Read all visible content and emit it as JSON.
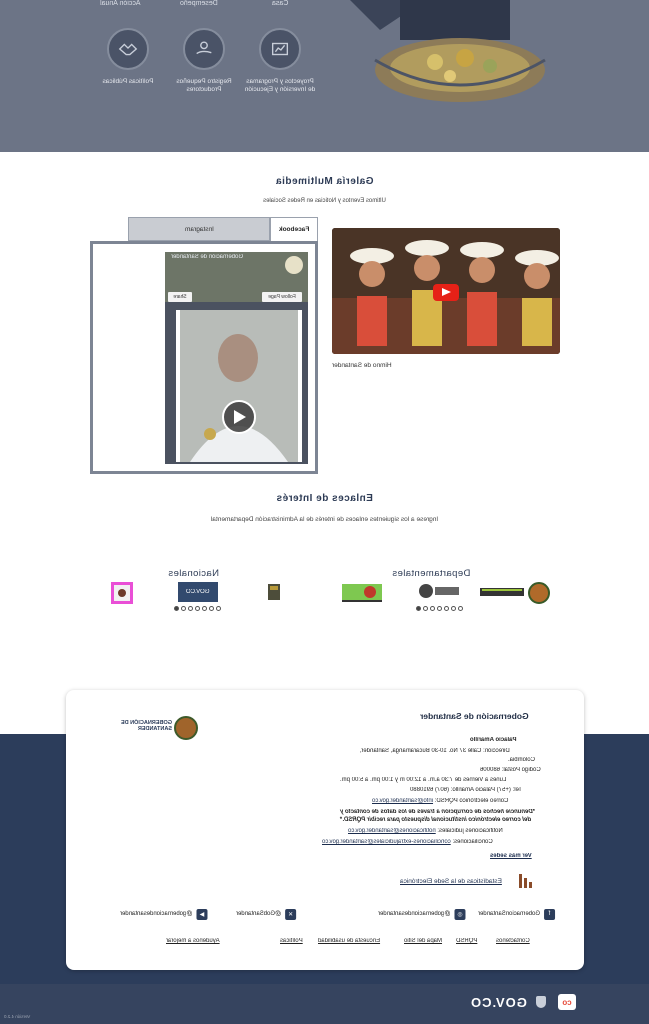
{
  "hero": {
    "captions": [
      "Acción Anual",
      "Desempeño",
      "Casa"
    ],
    "cards": [
      {
        "label": "Proyectos y Programas de Inversión y Ejecución",
        "icon": "folder-chart-icon"
      },
      {
        "label": "Registro Pequeños Productores",
        "icon": "hand-coins-icon"
      },
      {
        "label": "Políticas Públicas",
        "icon": "handshake-icon"
      }
    ]
  },
  "gallery": {
    "title": "Galería Multimedia",
    "subtitle": "Últimos Eventos y Noticias en Redes Sociales",
    "video_caption": "Himno de Santander",
    "tabs": {
      "facebook": "Facebook",
      "instagram": "Instagram"
    },
    "fb_page_name": "Gobernación de Santander",
    "fb_follow": "Follow Page",
    "fb_share": "Share"
  },
  "links": {
    "title": "Enlaces de Interés",
    "subtitle": "Ingrese a los siguientes enlaces de interés de la Administración Departamental",
    "departamentales": "Departamentales",
    "nacionales": "Nacionales",
    "gov_logo_text": "GOV.CO"
  },
  "footer": {
    "org_name": "Gobernación de Santander",
    "logo_text": "GOBERNACIÓN DE SANTANDER",
    "palace": "Palacio Amarillo",
    "address": "Dirección: Calle 37 No. 10-30 Bucaramanga, Santander,",
    "country": "Colombia.",
    "postal": "Código Postal: 680006",
    "hours": "Lunes a Viernes de 7:30 a.m. a 12:00 m y 1:00 pm. a 5:00 pm.",
    "phone": "Tel: (+57) Palacio Amarillo: (607) 6910880",
    "email_label": "Correo electrónico PQRSD: ",
    "email": "info@santander.gov.co",
    "note": "*Denuncie hechos de corrupción a través de los datos de contacto y del correo electrónico institucional dispuesto para recibir PQRSD.*",
    "judicial_label": "Notificaciones judiciales: ",
    "judicial_email": "notificaciones@santander.gov.co",
    "concil_label": "Conciliaciones: ",
    "concil_email": "conciliaciones-extrajudiciales@santander.gov.co",
    "see_more": "Ver más sedes",
    "stats": "Estadísticas de la Sede Electrónica",
    "socials": [
      "GobernacionSantander",
      "@gobernaciondesantander",
      "@GobSantander",
      "@gobernaciondesantander"
    ],
    "bottom_links": [
      "Contáctenos",
      "PQRSD",
      "Mapa del Sitio",
      "Encuesta de usabilidad",
      "Políticas",
      "Ayúdenos a mejorar"
    ]
  },
  "gov_bar": {
    "text": "GOV.CO",
    "logo": "co"
  },
  "version": "Versión 4.2.0"
}
